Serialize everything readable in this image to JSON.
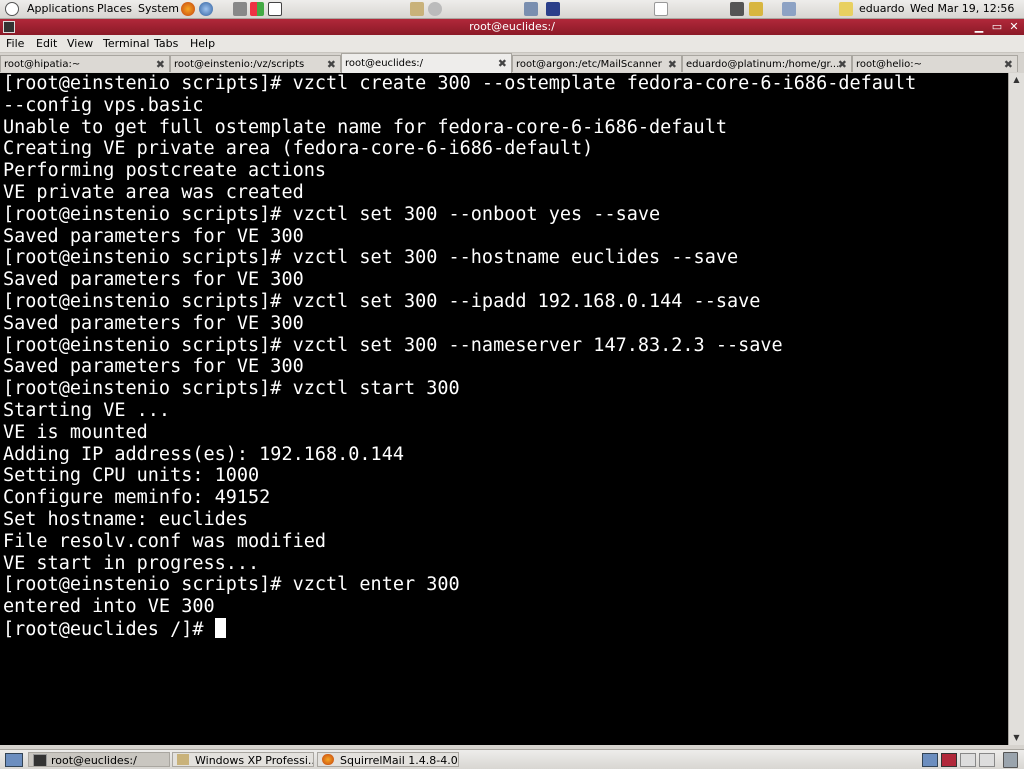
{
  "top_panel": {
    "applications": "Applications",
    "places": "Places",
    "system": "System",
    "user": "eduardo",
    "clock": "Wed Mar 19, 12:56"
  },
  "window": {
    "title": "root@euclides:/"
  },
  "menu": [
    "File",
    "Edit",
    "View",
    "Terminal",
    "Tabs",
    "Help"
  ],
  "tabs": [
    {
      "label": "root@hipatia:~",
      "active": false
    },
    {
      "label": "root@einstenio:/vz/scripts",
      "active": false
    },
    {
      "label": "root@euclides:/",
      "active": true
    },
    {
      "label": "root@argon:/etc/MailScanner",
      "active": false
    },
    {
      "label": "eduardo@platinum:/home/gr...",
      "active": false
    },
    {
      "label": "root@helio:~",
      "active": false
    }
  ],
  "terminal": {
    "lines": [
      "[root@einstenio scripts]# vzctl create 300 --ostemplate fedora-core-6-i686-default",
      "--config vps.basic",
      "Unable to get full ostemplate name for fedora-core-6-i686-default",
      "Creating VE private area (fedora-core-6-i686-default)",
      "Performing postcreate actions",
      "VE private area was created",
      "[root@einstenio scripts]# vzctl set 300 --onboot yes --save",
      "Saved parameters for VE 300",
      "[root@einstenio scripts]# vzctl set 300 --hostname euclides --save",
      "Saved parameters for VE 300",
      "[root@einstenio scripts]# vzctl set 300 --ipadd 192.168.0.144 --save",
      "Saved parameters for VE 300",
      "[root@einstenio scripts]# vzctl set 300 --nameserver 147.83.2.3 --save",
      "Saved parameters for VE 300",
      "[root@einstenio scripts]# vzctl start 300",
      "Starting VE ...",
      "VE is mounted",
      "Adding IP address(es): 192.168.0.144",
      "Setting CPU units: 1000",
      "Configure meminfo: 49152",
      "Set hostname: euclides",
      "File resolv.conf was modified",
      "VE start in progress...",
      "[root@einstenio scripts]# vzctl enter 300",
      "entered into VE 300"
    ],
    "prompt": "[root@euclides /]# "
  },
  "taskbar": [
    {
      "label": "root@euclides:/",
      "active": true
    },
    {
      "label": "Windows XP Professi...",
      "active": false
    },
    {
      "label": "SquirrelMail 1.4.8-4.0...",
      "active": false
    }
  ],
  "colors": {
    "title_bar": "#a0212f",
    "terminal_bg": "#000000",
    "terminal_fg": "#ffffff"
  }
}
